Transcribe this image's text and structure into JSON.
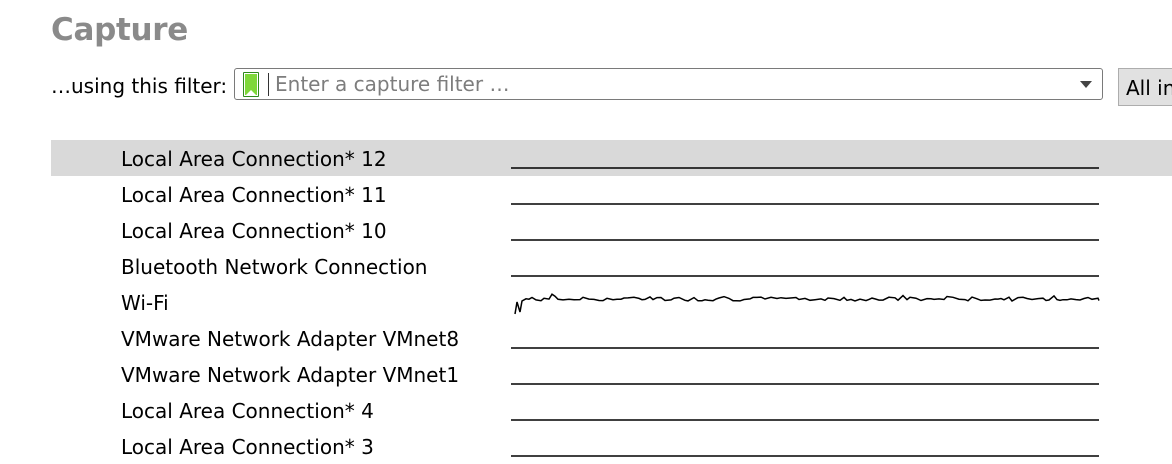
{
  "section_title": "Capture",
  "filter": {
    "label": "…using this filter:",
    "placeholder": "Enter a capture filter …",
    "value": "",
    "bookmark_color": "#7fd83a"
  },
  "interface_type_select": {
    "selected": "All in"
  },
  "interfaces": [
    {
      "name": "Local Area Connection* 12",
      "selected": true,
      "activity": "flat"
    },
    {
      "name": "Local Area Connection* 11",
      "selected": false,
      "activity": "flat"
    },
    {
      "name": "Local Area Connection* 10",
      "selected": false,
      "activity": "flat"
    },
    {
      "name": "Bluetooth Network Connection",
      "selected": false,
      "activity": "flat"
    },
    {
      "name": "Wi-Fi",
      "selected": false,
      "activity": "traffic"
    },
    {
      "name": "VMware Network Adapter VMnet8",
      "selected": false,
      "activity": "flat"
    },
    {
      "name": "VMware Network Adapter VMnet1",
      "selected": false,
      "activity": "flat"
    },
    {
      "name": "Local Area Connection* 4",
      "selected": false,
      "activity": "flat"
    },
    {
      "name": "Local Area Connection* 3",
      "selected": false,
      "activity": "flat"
    }
  ],
  "colors": {
    "selected_row_bg": "#d9d9d9",
    "title_color": "#8a8a8a"
  }
}
